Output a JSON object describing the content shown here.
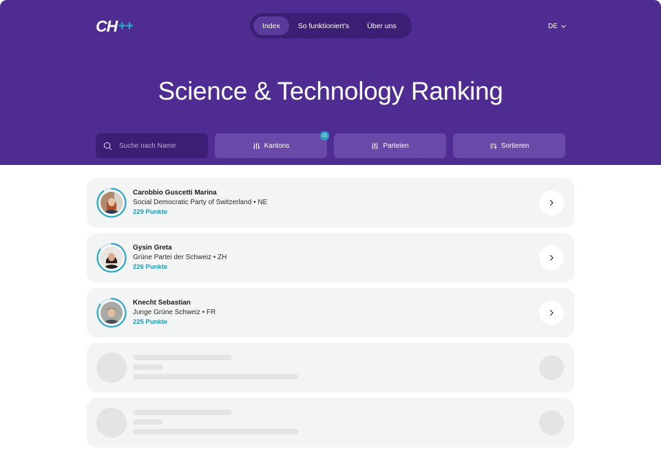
{
  "header": {
    "logo_main": "CH",
    "logo_accent": "++",
    "nav": [
      {
        "label": "Index",
        "active": true
      },
      {
        "label": "So funktioniert's",
        "active": false
      },
      {
        "label": "Über uns",
        "active": false
      }
    ],
    "language": "DE",
    "title": "Science & Technology Ranking"
  },
  "filters": {
    "search_placeholder": "Suche nach Name",
    "kantons_label": "Kantons",
    "kantons_badge": "21",
    "parteien_label": "Parteien",
    "sortieren_label": "Sortieren"
  },
  "ranking": [
    {
      "name": "Carobbio Guscetti Marina",
      "party": "Social Democratic Party of Switzerland • NE",
      "points": "229 Punkte",
      "score_fraction": 0.9
    },
    {
      "name": "Gysin Greta",
      "party": "Grüne Partei der Schweiz • ZH",
      "points": "226 Punkte",
      "score_fraction": 0.85
    },
    {
      "name": "Knecht Sebastian",
      "party": "Junge Grüne Schweiz • FR",
      "points": "225 Punkte",
      "score_fraction": 0.85
    }
  ],
  "colors": {
    "hero": "#4f2c91",
    "accent": "#2aa6c6"
  },
  "icons": {
    "search": "search-icon",
    "filter": "sliders-icon",
    "sort": "sort-icon",
    "chevron": "chevron-right-icon"
  }
}
